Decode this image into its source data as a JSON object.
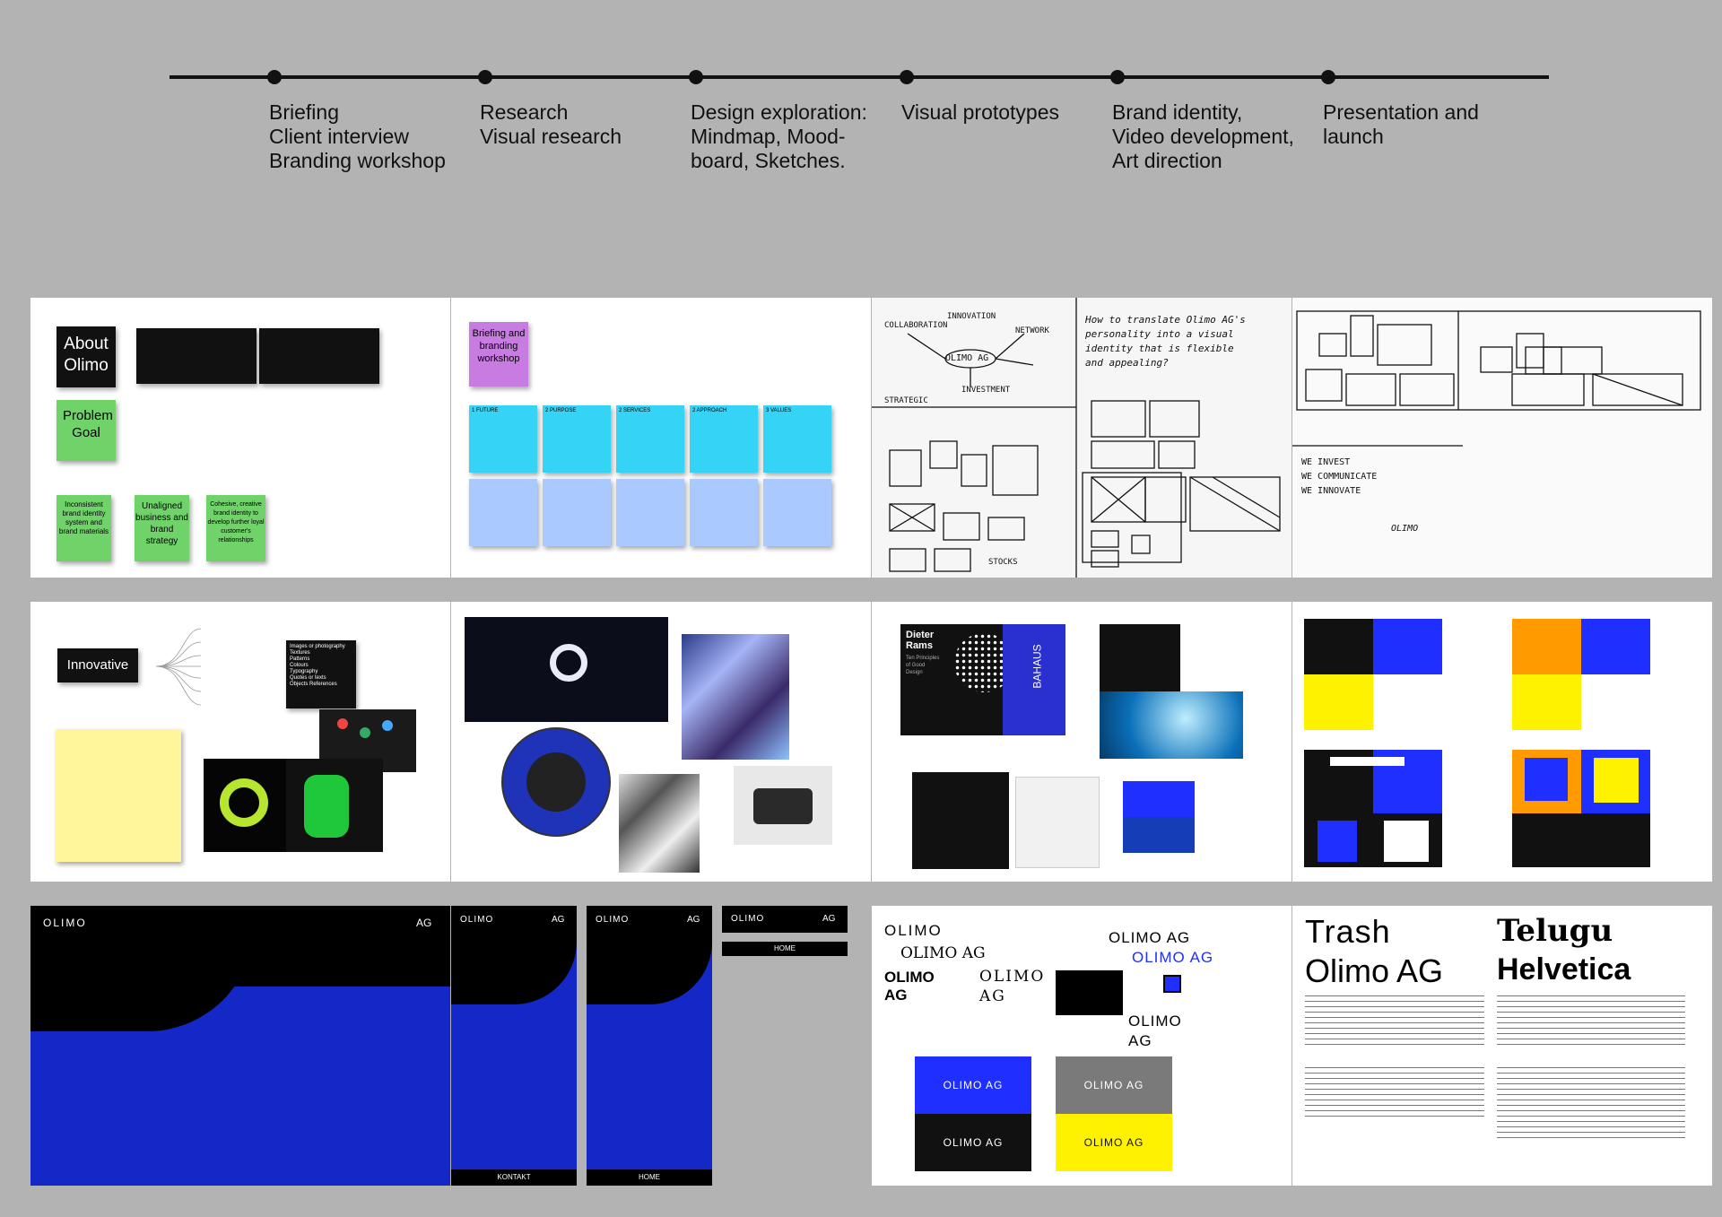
{
  "timeline": {
    "steps": [
      {
        "lines": [
          "Briefing",
          "Client interview",
          "Branding workshop"
        ]
      },
      {
        "lines": [
          "Research",
          "Visual research"
        ]
      },
      {
        "lines": [
          "Design exploration:",
          "Mindmap, Mood-",
          "board, Sketches."
        ]
      },
      {
        "lines": [
          "Visual prototypes"
        ]
      },
      {
        "lines": [
          "Brand identity,",
          "Video development,",
          "Art direction"
        ]
      },
      {
        "lines": [
          "Presentation and",
          "launch"
        ]
      }
    ]
  },
  "briefing_board": {
    "about_olimo": "About Olimo",
    "problem_goal": "Problem Goal",
    "problems": [
      "Inconsistent brand identity system and brand materials",
      "Unaligned business and brand strategy",
      "Cohesive, creative brand identity to develop further loyal customer's relationships"
    ]
  },
  "workshop_board": {
    "title": "Briefing and branding workshop",
    "questions": [
      "1 FUTURE",
      "2 PURPOSE",
      "2 SERVICES",
      "2 APPROACH",
      "3 VALUES"
    ]
  },
  "sketch_board": {
    "center_label": "OLIMO AG",
    "words": [
      "COLLABORATION",
      "INNOVATION",
      "NETWORK",
      "INVESTMENT",
      "STRATEGIC",
      "STOCKS"
    ],
    "notes": [
      "How to translate Olimo AG's",
      "personality into a visual",
      "identity that is flexible",
      "and appealing?"
    ]
  },
  "logo_board": {
    "statements": [
      "WE INVEST",
      "WE COMMUNICATE",
      "WE INNOVATE"
    ],
    "signature": "OLIMO"
  },
  "mindmap_board": {
    "innovative": "Innovative",
    "list": [
      "Images or photography",
      "Textures",
      "Patterns",
      "Colours",
      "Typography",
      "Quotes or texts",
      "Objects References"
    ]
  },
  "moodboard_board": {},
  "design_board": {
    "book_title": "Dieter Rams",
    "book_subtitle": "Ten Principles of Good Design",
    "poster_text": "BAHAUS"
  },
  "color_board": {
    "colors": {
      "black": "#111111",
      "blue": "#1f2fff",
      "yellow": "#fff200",
      "orange": "#ff9a00"
    }
  },
  "web_board": {
    "brand": "OLIMO",
    "suffix": "AG",
    "nav_home": "HOME",
    "nav_contact": "KONTAKT"
  },
  "logo_variants_board": {
    "wordmarks": [
      "OLIMO",
      "OLIMO AG",
      "OLIMO AG",
      "OLIMO AG",
      "OLIMO AG",
      "OLIMO AG",
      "OLIMO AG"
    ]
  },
  "type_board": {
    "fonts": [
      "Trash",
      "Olimo AG",
      "Telugu",
      "Helvetica"
    ]
  }
}
